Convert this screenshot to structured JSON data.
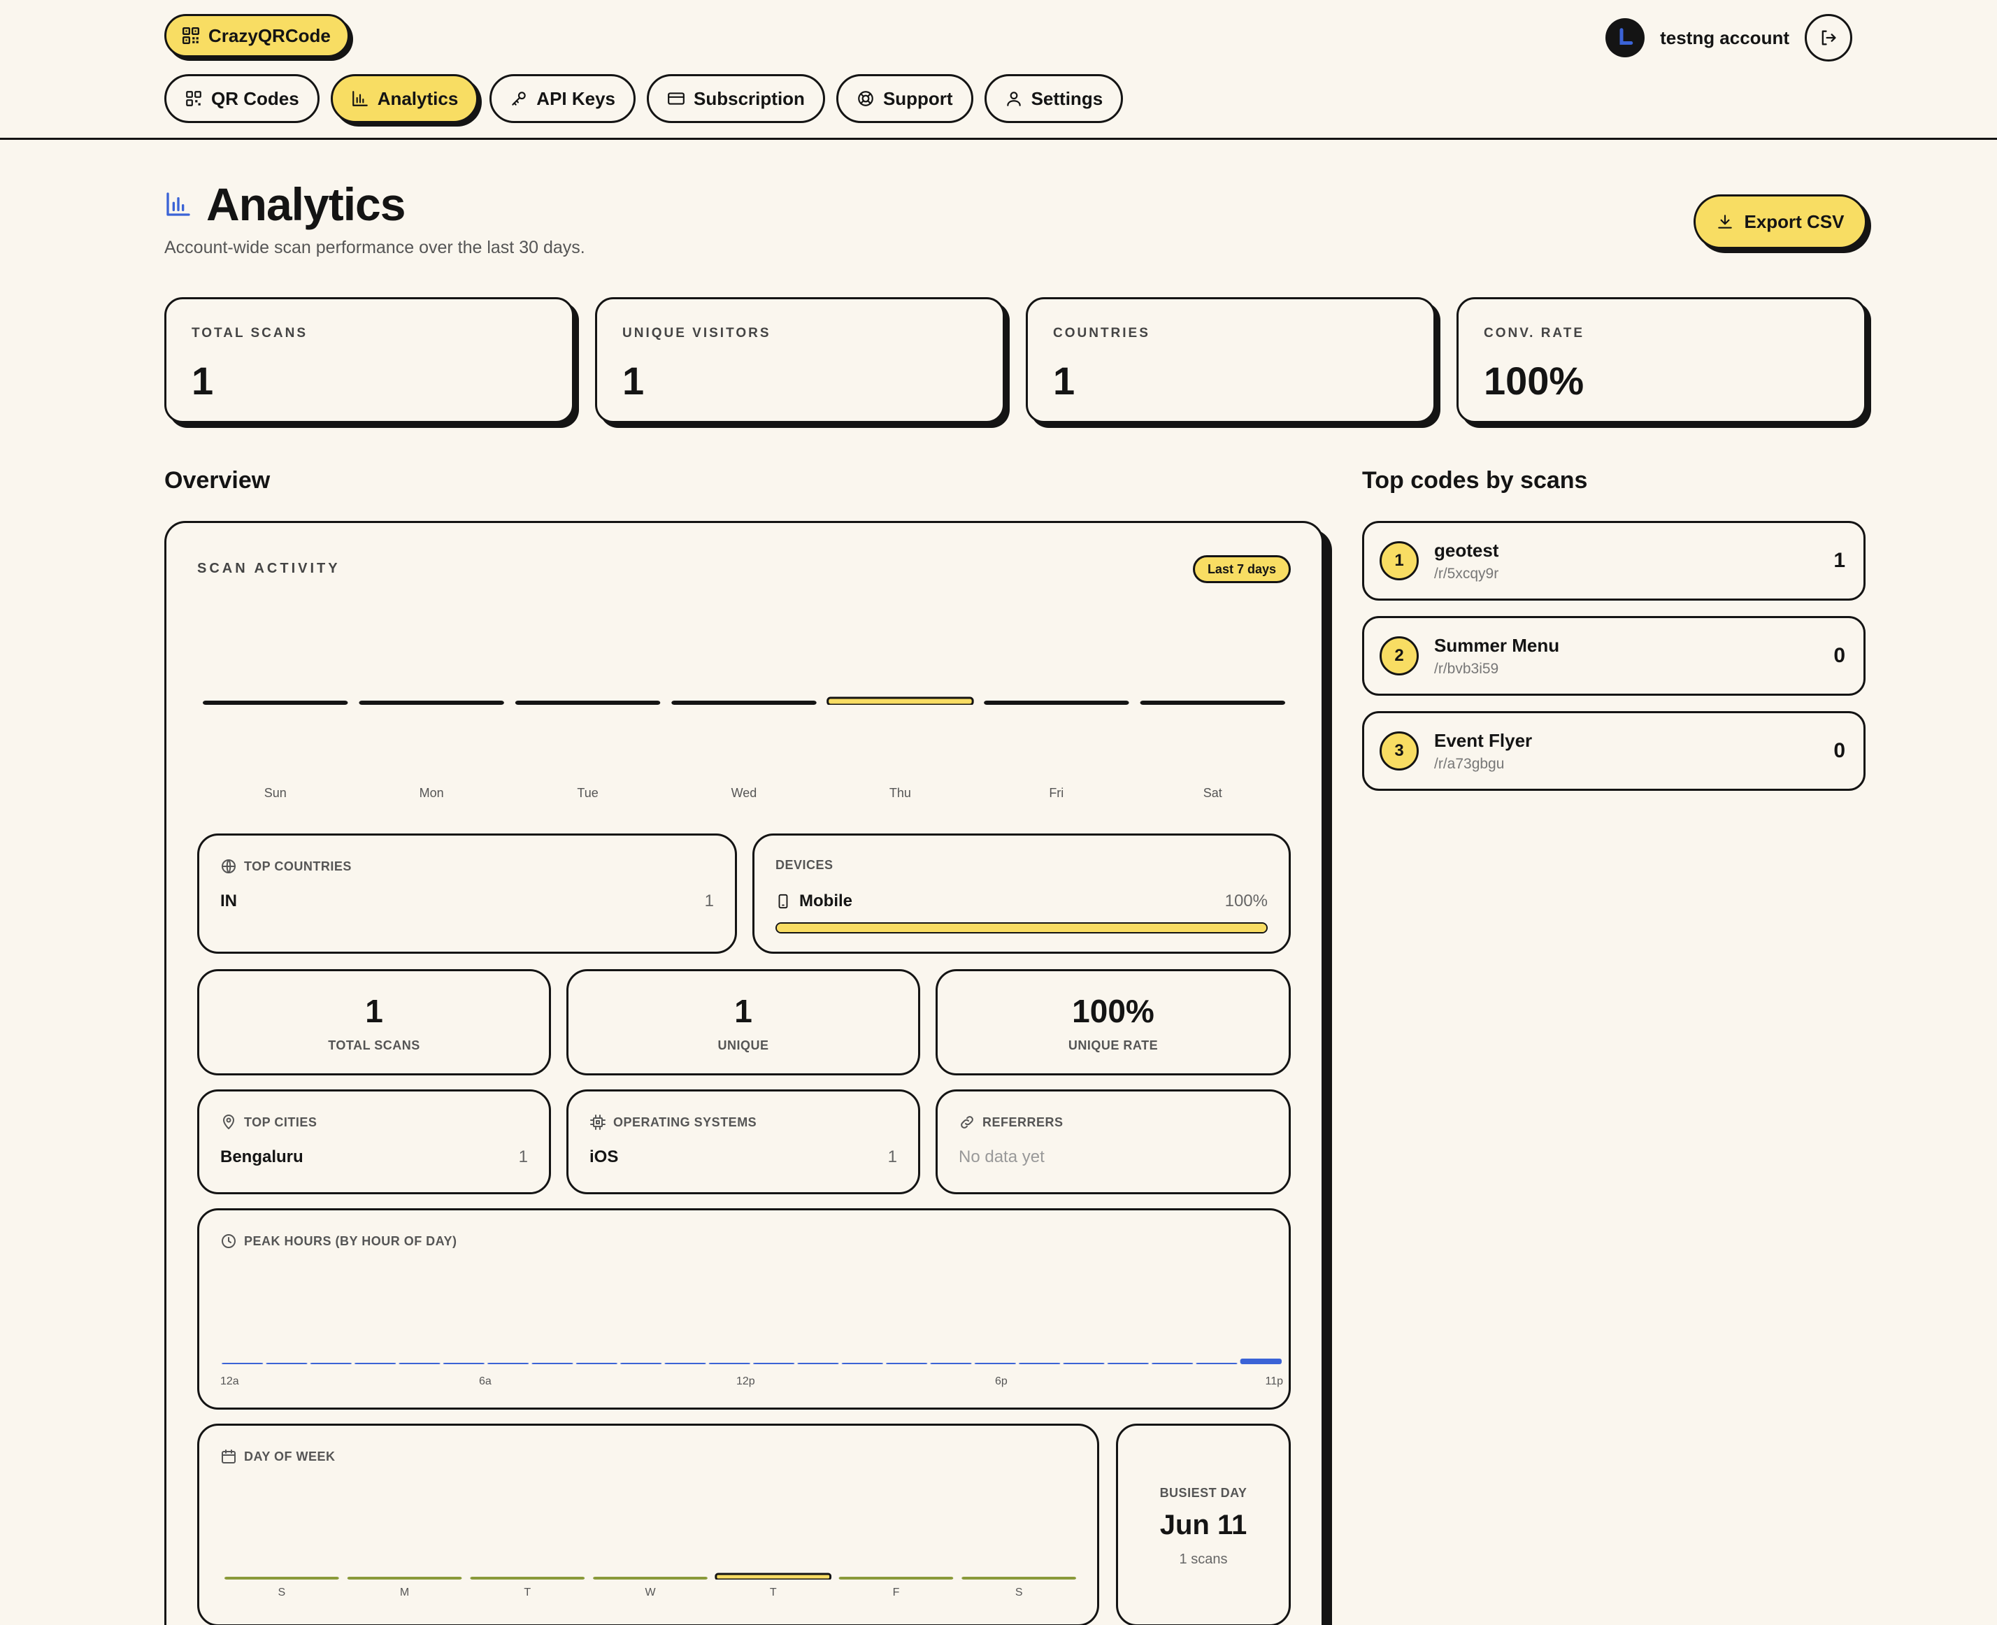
{
  "brand": {
    "name": "CrazyQRCode",
    "icon": "qr-icon"
  },
  "nav": [
    {
      "label": "QR Codes",
      "icon": "qr-icon",
      "active": false
    },
    {
      "label": "Analytics",
      "icon": "bar-chart-icon",
      "active": true
    },
    {
      "label": "API Keys",
      "icon": "key-icon",
      "active": false
    },
    {
      "label": "Subscription",
      "icon": "card-icon",
      "active": false
    },
    {
      "label": "Support",
      "icon": "lifebuoy-icon",
      "active": false
    },
    {
      "label": "Settings",
      "icon": "user-icon",
      "active": false
    }
  ],
  "account": {
    "name": "testng account"
  },
  "page": {
    "title": "Analytics",
    "subtitle": "Account-wide scan performance over the last 30 days.",
    "export_label": "Export CSV"
  },
  "stats": [
    {
      "label": "TOTAL SCANS",
      "value": "1"
    },
    {
      "label": "UNIQUE VISITORS",
      "value": "1"
    },
    {
      "label": "COUNTRIES",
      "value": "1"
    },
    {
      "label": "CONV. RATE",
      "value": "100%"
    }
  ],
  "overview": {
    "title": "Overview",
    "scan_activity_label": "SCAN ACTIVITY",
    "range_pill": "Last 7 days",
    "top_countries": {
      "label": "TOP COUNTRIES",
      "items": [
        {
          "name": "IN",
          "count": "1"
        }
      ]
    },
    "devices": {
      "label": "DEVICES",
      "items": [
        {
          "name": "Mobile",
          "percent": "100%",
          "fraction": 1.0
        }
      ]
    },
    "summary": [
      {
        "value": "1",
        "label": "TOTAL SCANS"
      },
      {
        "value": "1",
        "label": "UNIQUE"
      },
      {
        "value": "100%",
        "label": "UNIQUE RATE"
      }
    ],
    "top_cities": {
      "label": "TOP CITIES",
      "items": [
        {
          "name": "Bengaluru",
          "count": "1"
        }
      ]
    },
    "operating_systems": {
      "label": "OPERATING SYSTEMS",
      "items": [
        {
          "name": "iOS",
          "count": "1"
        }
      ]
    },
    "referrers": {
      "label": "REFERRERS",
      "empty": "No data yet"
    },
    "peak_hours": {
      "label": "PEAK HOURS (BY HOUR OF DAY)",
      "ticks": [
        "12a",
        "6a",
        "12p",
        "6p",
        "11p"
      ]
    },
    "day_of_week": {
      "label": "DAY OF WEEK"
    },
    "busiest_day": {
      "label": "BUSIEST DAY",
      "value": "Jun 11",
      "sub": "1 scans"
    }
  },
  "chart_data": [
    {
      "type": "bar",
      "categories": [
        "Sun",
        "Mon",
        "Tue",
        "Wed",
        "Thu",
        "Fri",
        "Sat"
      ],
      "values": [
        0,
        0,
        0,
        0,
        1,
        0,
        0
      ],
      "title": "SCAN ACTIVITY",
      "highlight_color": "#f8dd63",
      "bar_color": "#141414"
    },
    {
      "type": "bar",
      "categories": [
        "0",
        "1",
        "2",
        "3",
        "4",
        "5",
        "6",
        "7",
        "8",
        "9",
        "10",
        "11",
        "12",
        "13",
        "14",
        "15",
        "16",
        "17",
        "18",
        "19",
        "20",
        "21",
        "22",
        "23"
      ],
      "values": [
        0,
        0,
        0,
        0,
        0,
        0,
        0,
        0,
        0,
        0,
        0,
        0,
        0,
        0,
        0,
        0,
        0,
        0,
        0,
        0,
        0,
        0,
        0,
        1
      ],
      "title": "PEAK HOURS (BY HOUR OF DAY)",
      "bar_color": "#3b63d6"
    },
    {
      "type": "bar",
      "categories": [
        "S",
        "M",
        "T",
        "W",
        "T",
        "F",
        "S"
      ],
      "values": [
        0,
        0,
        0,
        0,
        1,
        0,
        0
      ],
      "title": "DAY OF WEEK",
      "bar_color": "#8a9a3a",
      "highlight_color": "#f8dd63"
    }
  ],
  "top_codes": {
    "title": "Top codes by scans",
    "items": [
      {
        "rank": "1",
        "name": "geotest",
        "path": "/r/5xcqy9r",
        "count": "1"
      },
      {
        "rank": "2",
        "name": "Summer Menu",
        "path": "/r/bvb3i59",
        "count": "0"
      },
      {
        "rank": "3",
        "name": "Event Flyer",
        "path": "/r/a73gbgu",
        "count": "0"
      }
    ]
  },
  "colors": {
    "accent": "#f8dd63",
    "ink": "#141414",
    "background": "#faf6ee",
    "blue": "#3b63d6"
  }
}
